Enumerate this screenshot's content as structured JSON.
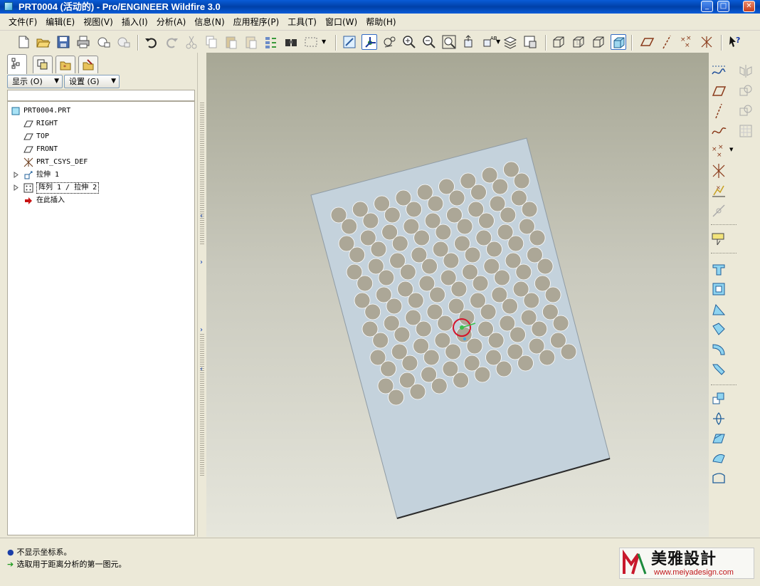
{
  "window": {
    "title": "PRT0004 (活动的) - Pro/ENGINEER Wildfire 3.0",
    "controls": [
      "minimize",
      "maximize",
      "close"
    ]
  },
  "menu": [
    "文件(F)",
    "编辑(E)",
    "视图(V)",
    "插入(I)",
    "分析(A)",
    "信息(N)",
    "应用程序(P)",
    "工具(T)",
    "窗口(W)",
    "帮助(H)"
  ],
  "toolbar_icons": [
    "new-icon",
    "open-icon",
    "save-icon",
    "print-icon",
    "send-mail-icon",
    "send-mail-attach-icon",
    "undo-icon",
    "redo-icon",
    "cut-icon",
    "copy-icon",
    "paste-icon",
    "paste-special-icon",
    "regenerate-icon",
    "find-icon",
    "select-box-icon",
    "repaint-icon",
    "spin-center-icon",
    "orient-mode-icon",
    "zoom-in-icon",
    "zoom-out-icon",
    "refit-icon",
    "reorient-icon",
    "saved-views-icon",
    "layers-icon",
    "view-manager-icon",
    "wireframe-icon",
    "hidden-line-icon",
    "no-hidden-icon",
    "shading-icon",
    "datum-planes-icon",
    "datum-axes-icon",
    "datum-points-icon",
    "coordinate-systems-icon",
    "context-help-icon"
  ],
  "model_tree": {
    "tabs": [
      "model-tree-tab",
      "layers-tab",
      "favorites-tab",
      "folder-browser-tab"
    ],
    "show_button": "显示 (O)",
    "settings_button": "设置 (G)",
    "items": [
      {
        "label": "PRT0004.PRT",
        "icon": "part-icon"
      },
      {
        "label": "RIGHT",
        "icon": "datum-plane-icon"
      },
      {
        "label": "TOP",
        "icon": "datum-plane-icon"
      },
      {
        "label": "FRONT",
        "icon": "datum-plane-icon"
      },
      {
        "label": "PRT_CSYS_DEF",
        "icon": "coordinate-system-icon"
      },
      {
        "label": "拉伸 1",
        "icon": "extrude-icon"
      },
      {
        "label": "阵列 1 / 拉伸 2",
        "icon": "pattern-icon"
      },
      {
        "label": "在此插入",
        "icon": "insert-here-arrow-icon"
      }
    ]
  },
  "graphics": {
    "model": "perforated plate",
    "hole_rows": 14,
    "holes_per_row": 9,
    "plate_color": "#c4d2dc",
    "hole_color": "#aca797"
  },
  "right_toolbar_icons": [
    "sketch-tool-icon",
    "datum-plane-tool-icon",
    "datum-axis-tool-icon",
    "datum-curve-tool-icon",
    "datum-point-tool-icon",
    "coordinate-system-tool-icon",
    "analysis-feature-icon",
    "insert-datum-icon",
    "annotation-feature-icon",
    "extrude-tool-icon",
    "revolve-tool-icon",
    "variable-sweep-icon",
    "boundary-blend-icon",
    "style-tool-icon",
    "warp-icon",
    "hole-tool-icon",
    "shell-tool-icon",
    "rib-tool-icon",
    "draft-tool-icon",
    "round-tool-icon",
    "chamfer-tool-icon",
    "mirror-tool-icon",
    "merge-tool-icon",
    "trim-tool-icon",
    "pattern-tool-icon"
  ],
  "messages": [
    {
      "icon": "info-bullet-icon",
      "text": "不显示坐标系。"
    },
    {
      "icon": "prompt-arrow-icon",
      "text": "选取用于距离分析的第一图元。"
    }
  ],
  "watermark": {
    "name": "美雅設計",
    "url": "www.meiyadesign.com"
  }
}
